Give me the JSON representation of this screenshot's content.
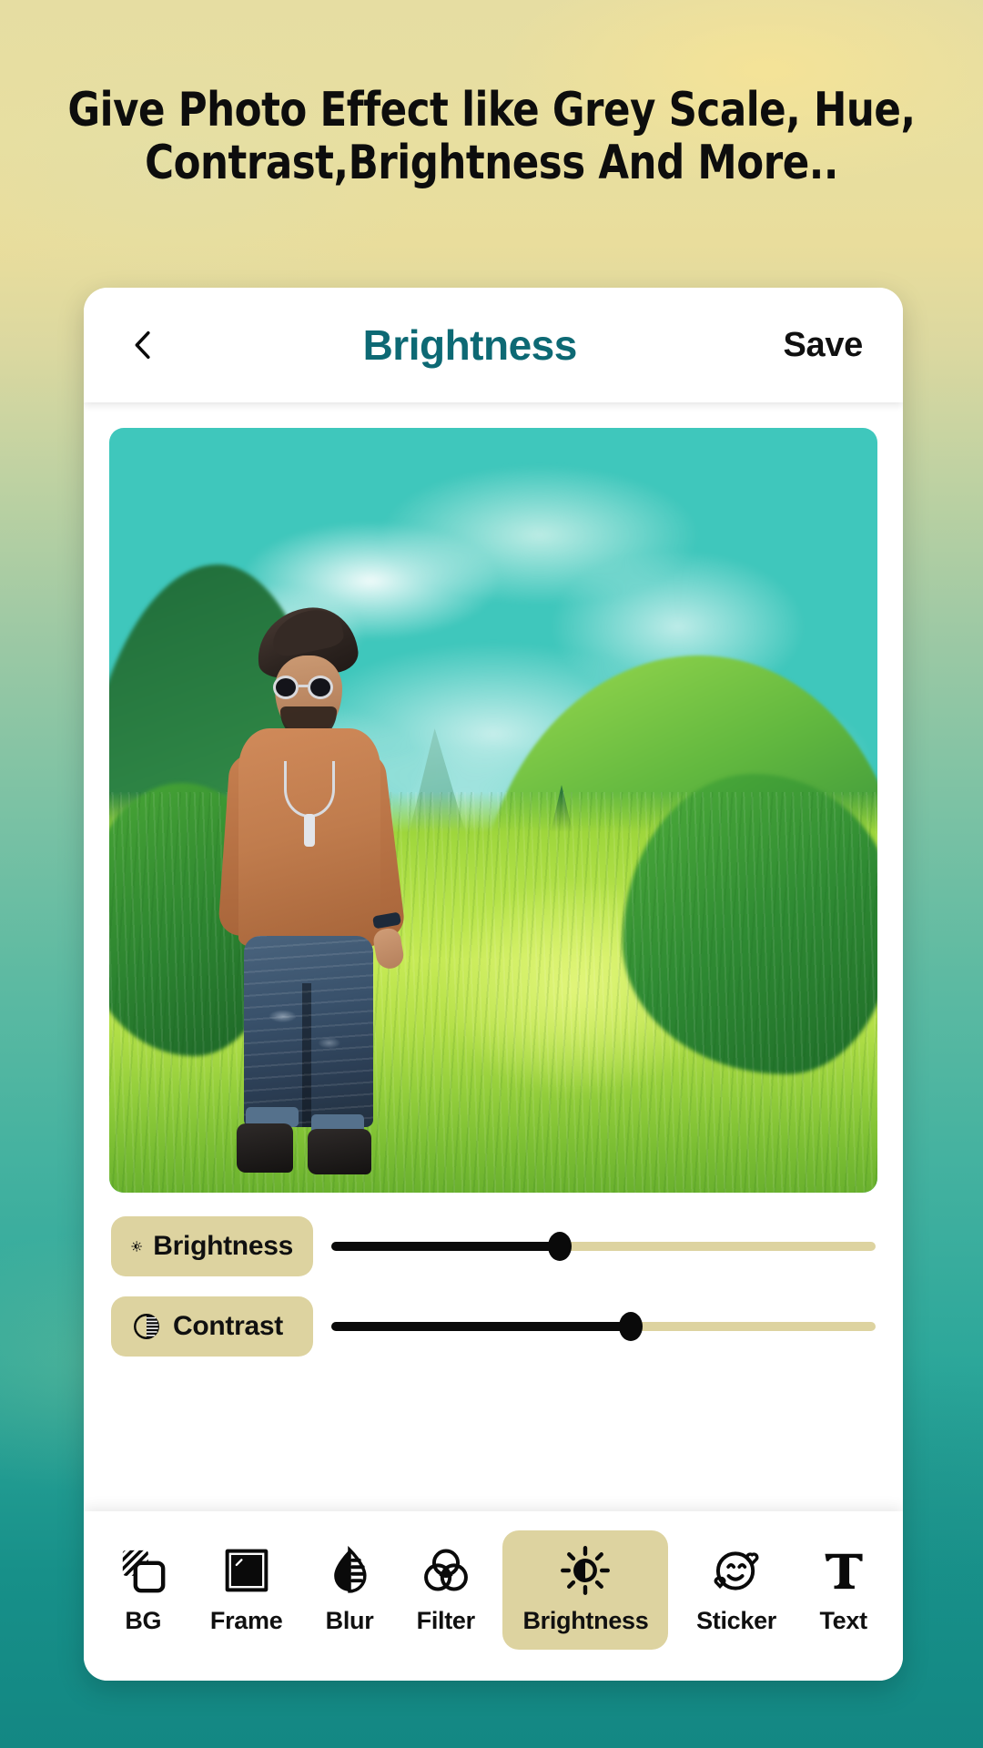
{
  "promo": {
    "headline_line1": "Give Photo Effect like Grey Scale, Hue,",
    "headline_line2": "Contrast,Brightness And More.."
  },
  "header": {
    "back_icon": "chevron-left-icon",
    "title": "Brightness",
    "save_label": "Save",
    "title_color": "#0d6974"
  },
  "photo": {
    "alt": "Man in orange sweater and ripped jeans walking on a sunlit green meadow with teal sky and mossy mountains"
  },
  "adjustments": [
    {
      "icon": "brightness-sun-icon",
      "label": "Brightness",
      "value": 42
    },
    {
      "icon": "contrast-circle-icon",
      "label": "Contrast",
      "value": 55
    }
  ],
  "toolbar": {
    "active": "Brightness",
    "accent": "#ddd3a0",
    "items": [
      {
        "icon": "background-layers-icon",
        "label": "BG"
      },
      {
        "icon": "picture-frame-icon",
        "label": "Frame"
      },
      {
        "icon": "blur-droplet-icon",
        "label": "Blur"
      },
      {
        "icon": "filter-circles-icon",
        "label": "Filter"
      },
      {
        "icon": "brightness-sun-icon",
        "label": "Brightness"
      },
      {
        "icon": "sticker-smiley-icon",
        "label": "Sticker"
      },
      {
        "icon": "text-t-icon",
        "label": "Text"
      }
    ]
  },
  "background": {
    "top_color": "#e6dda2",
    "mid_color": "#5dbaa2",
    "bottom_color": "#138783"
  }
}
